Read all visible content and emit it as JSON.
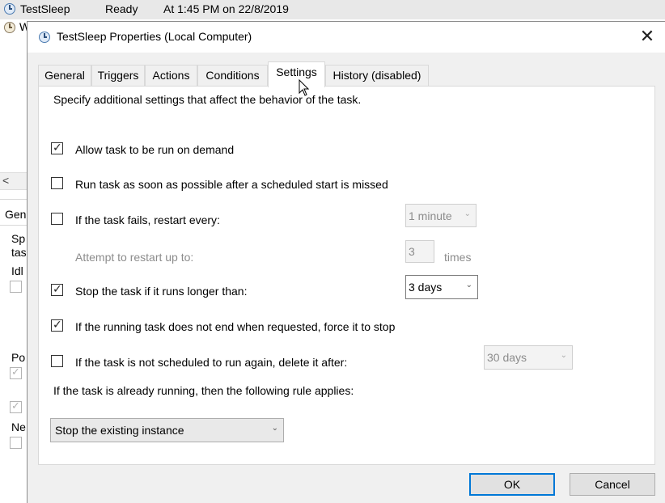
{
  "background": {
    "task_row": {
      "name": "TestSleep",
      "status": "Ready",
      "trigger": "At 1:45 PM on 22/8/2019"
    },
    "second_row_fragment": "W",
    "scroll_arrow": "<",
    "left_fragments": {
      "gen": "Gene",
      "sp": "Sp",
      "tas": "tas",
      "idl": "Idl",
      "po": "Po",
      "ne": "Ne"
    }
  },
  "dialog": {
    "title": "TestSleep Properties (Local Computer)",
    "close_glyph": "✕",
    "tabs": [
      {
        "label": "General"
      },
      {
        "label": "Triggers"
      },
      {
        "label": "Actions"
      },
      {
        "label": "Conditions"
      },
      {
        "label": "Settings"
      },
      {
        "label": "History (disabled)"
      }
    ],
    "active_tab": "Settings",
    "settings": {
      "intro": "Specify additional settings that affect the behavior of the task.",
      "allow_on_demand": {
        "label": "Allow task to be run on demand",
        "checked": true
      },
      "run_asap": {
        "label": "Run task as soon as possible after a scheduled start is missed",
        "checked": false
      },
      "restart_every": {
        "label": "If the task fails, restart every:",
        "checked": false,
        "value": "1 minute"
      },
      "attempt_restart": {
        "label": "Attempt to restart up to:",
        "value": "3",
        "suffix": "times"
      },
      "stop_if_longer": {
        "label": "Stop the task if it runs longer than:",
        "checked": true,
        "value": "3 days"
      },
      "force_stop": {
        "label": "If the running task does not end when requested, force it to stop",
        "checked": true
      },
      "delete_after": {
        "label": "If the task is not scheduled to run again, delete it after:",
        "checked": false,
        "value": "30 days"
      },
      "rule_label": "If the task is already running, then the following rule applies:",
      "rule_value": "Stop the existing instance"
    },
    "buttons": {
      "ok": "OK",
      "cancel": "Cancel"
    },
    "arrow_glyph": "⌄"
  }
}
